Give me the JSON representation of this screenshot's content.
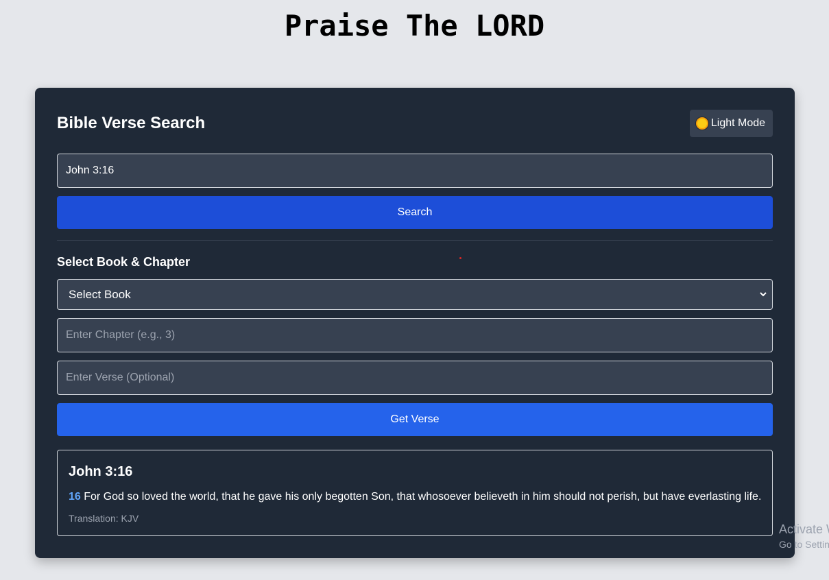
{
  "page": {
    "title": "Praise The LORD"
  },
  "card": {
    "heading": "Bible Verse Search",
    "mode_button": {
      "icon": "sun-icon",
      "label": "Light Mode"
    },
    "search": {
      "value": "John 3:16",
      "button_label": "Search"
    },
    "selector": {
      "section_label": "Select Book & Chapter",
      "book_select_value": "Select Book",
      "chapter_placeholder": "Enter Chapter (e.g., 3)",
      "verse_placeholder": "Enter Verse (Optional)",
      "button_label": "Get Verse"
    },
    "result": {
      "reference": "John 3:16",
      "verse_number": "16",
      "verse_text": " For God so loved the world, that he gave his only begotten Son, that whosoever believeth in him should not perish, but have everlasting life.",
      "translation": "Translation: KJV"
    }
  },
  "watermark": {
    "line1": "Activate Windows",
    "line2": "Go to Settings to activate Windows."
  },
  "colors": {
    "page_bg": "#e5e7eb",
    "card_bg": "#1f2937",
    "field_bg": "#374151",
    "search_button": "#1d4ed8",
    "get_verse_button": "#2563eb",
    "verse_number": "#60a5fa"
  }
}
